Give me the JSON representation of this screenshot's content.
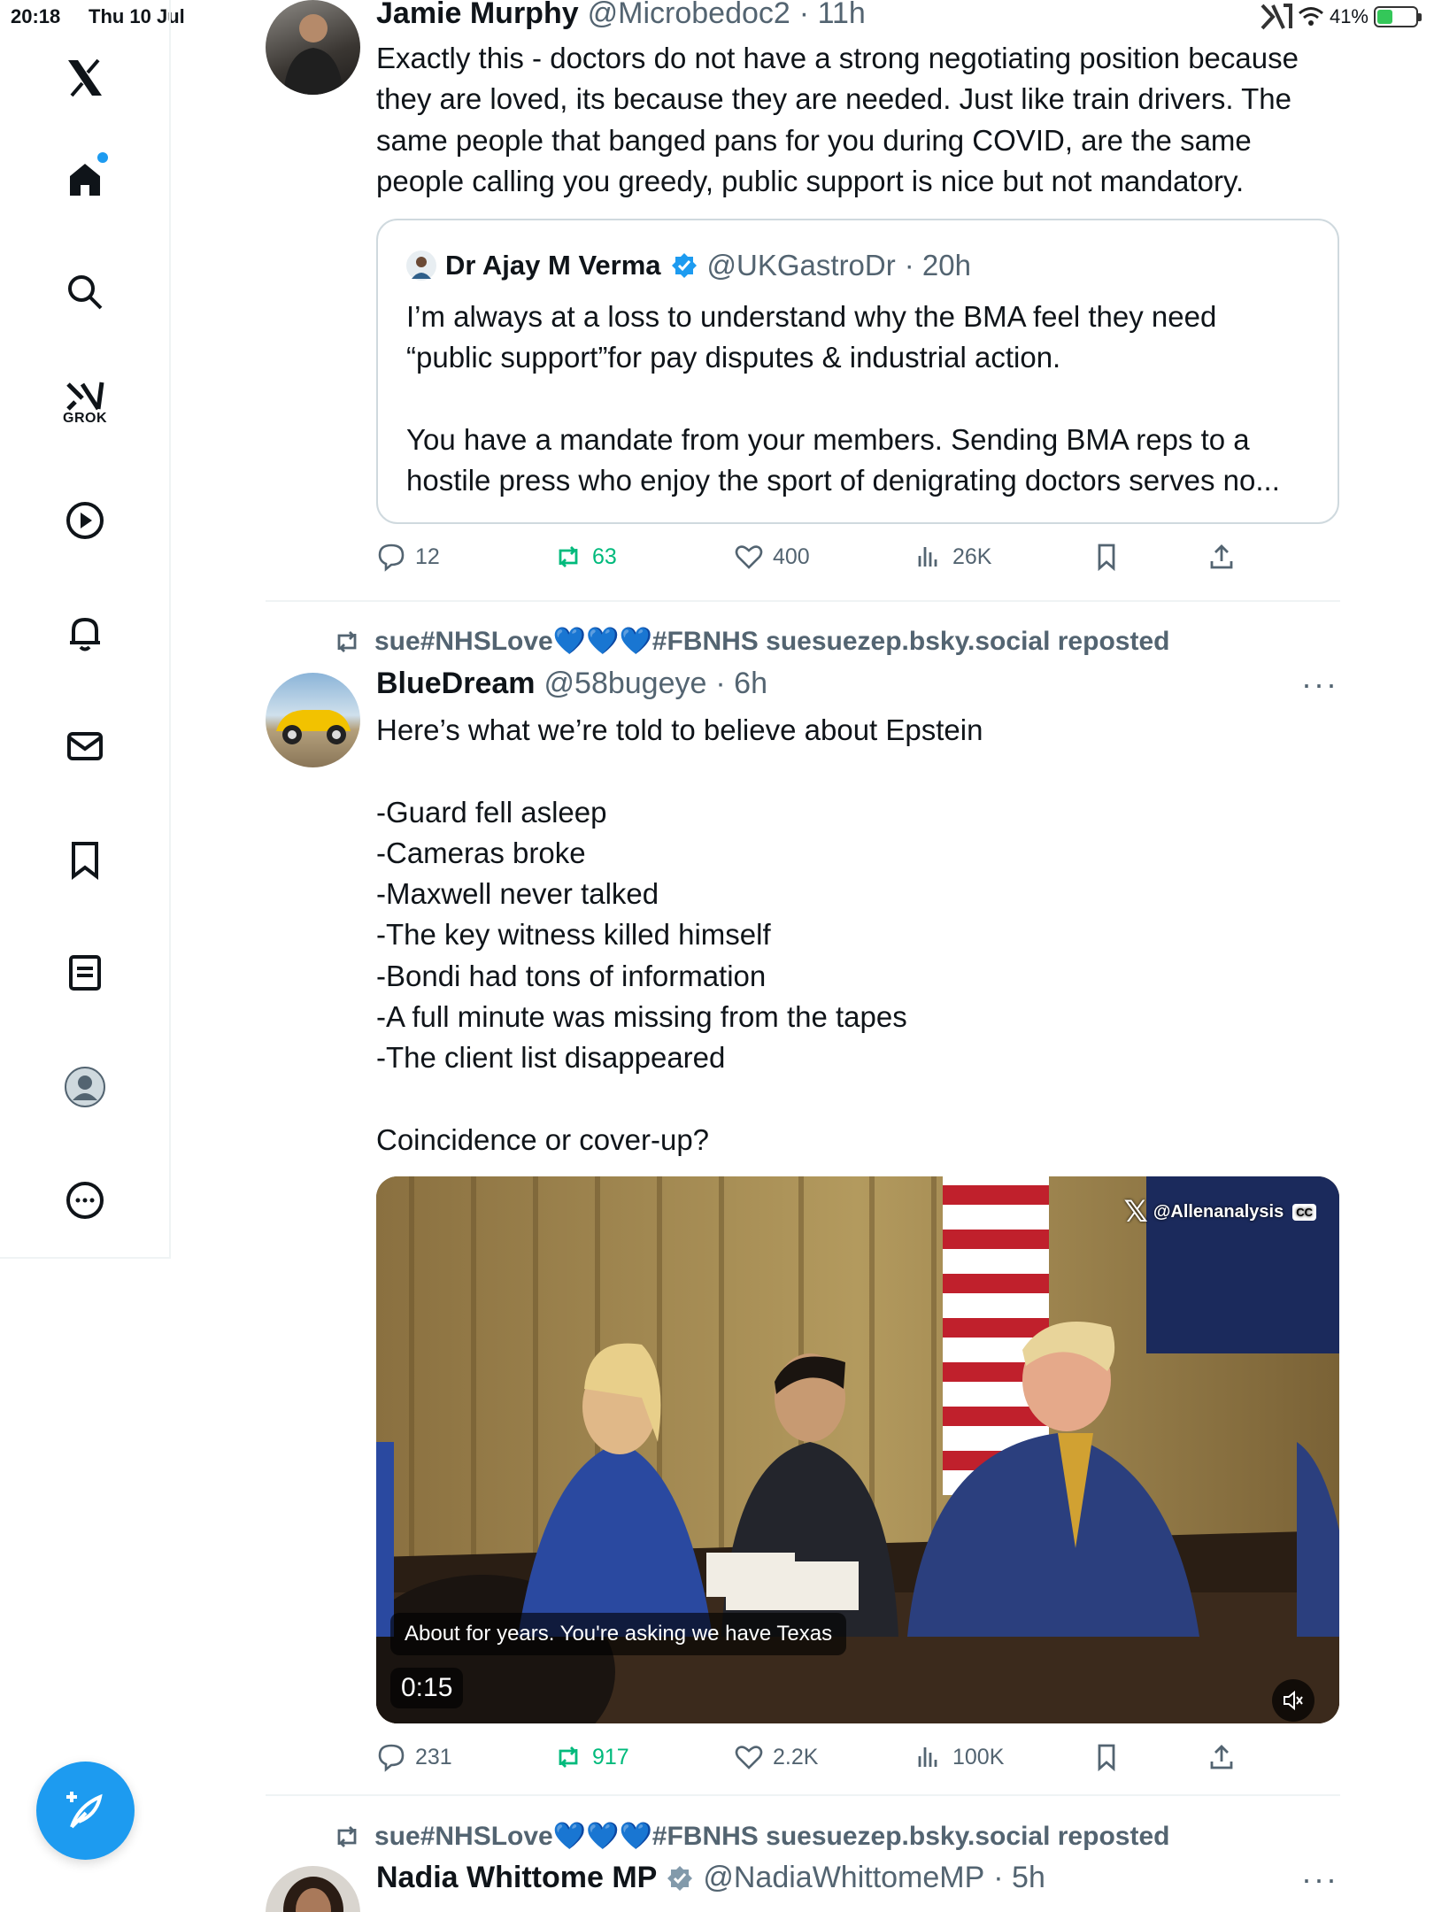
{
  "status_bar": {
    "time": "20:18",
    "date": "Thu 10 Jul",
    "battery": "41%",
    "battery_level": 0.41
  },
  "sidebar": {
    "grok_label": "GROK",
    "items": [
      "home",
      "search",
      "grok",
      "video",
      "notifications",
      "messages",
      "bookmarks",
      "lists",
      "profile",
      "more"
    ]
  },
  "tweet1": {
    "name": "Jamie Murphy",
    "handle": "@Microbedoc2",
    "time": "· 11h",
    "text": "Exactly this - doctors do not have a strong negotiating position because\nthey are loved, its because they are needed. Just like train drivers. The\nsame people that banged pans for you during COVID, are the same\npeople calling you greedy, public support is nice but not mandatory.",
    "quote": {
      "name": "Dr Ajay M Verma",
      "handle": "@UKGastroDr",
      "time": "· 20h",
      "text": "I’m always at a loss to understand why the BMA feel they need\n“public support”for pay disputes & industrial action.\n\nYou have a mandate from your members. Sending BMA reps to a\nhostile press who enjoy the sport of denigrating doctors serves no..."
    },
    "stats": {
      "replies": "12",
      "reposts": "63",
      "likes": "400",
      "views": "26K"
    }
  },
  "tweet2": {
    "repost_by": "sue#NHSLove💙💙💙#FBNHS suesuezep.bsky.social reposted",
    "name": "BlueDream",
    "handle": "@58bugeye",
    "time": "· 6h",
    "more": "···",
    "text": "Here’s what we’re told to believe about Epstein\n\n-Guard fell asleep\n-Cameras broke\n-Maxwell never talked\n-The key witness killed himself\n-Bondi had tons of information\n-A full minute was missing from the tapes\n-The client list disappeared\n\nCoincidence or cover-up?",
    "video": {
      "caption": "About for years. You're asking we have Texas",
      "duration": "0:15",
      "watermark": "@Allenanalysis",
      "cc": "CC"
    },
    "stats": {
      "replies": "231",
      "reposts": "917",
      "likes": "2.2K",
      "views": "100K"
    }
  },
  "tweet3": {
    "repost_by": "sue#NHSLove💙💙💙#FBNHS suesuezep.bsky.social reposted",
    "name": "Nadia Whittome MP",
    "handle": "@NadiaWhittomeMP",
    "time": "· 5h",
    "more": "···"
  }
}
